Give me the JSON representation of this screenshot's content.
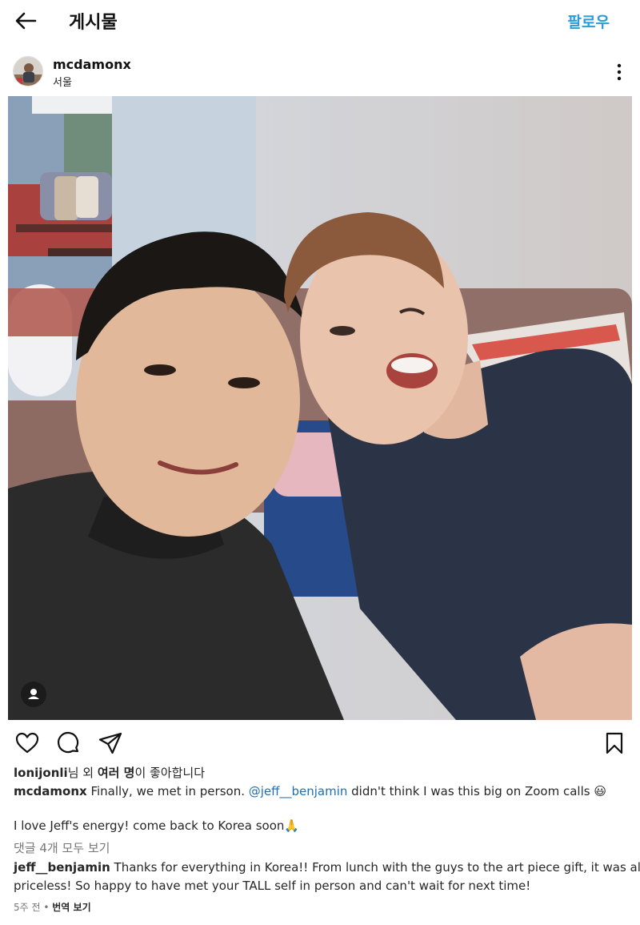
{
  "header": {
    "title": "게시물",
    "follow_label": "팔로우"
  },
  "post": {
    "username": "mcdamonx",
    "location": "서울"
  },
  "likes": {
    "user": "lonijonli",
    "mid1": "님 외 ",
    "others": "여러 명",
    "mid2": "이 좋아합니다"
  },
  "caption": {
    "username": "mcdamonx",
    "text1": " Finally, we met in person. ",
    "mention": "@jeff__benjamin",
    "text2": " didn't think I was this big on Zoom calls ",
    "emoji": "😃"
  },
  "caption2": {
    "text": "I love Jeff's energy! come back to Korea soon",
    "emoji": "🙏"
  },
  "view_comments": "댓글 4개 모두 보기",
  "comment": {
    "username": "jeff__benjamin",
    "line1": " Thanks for everything in Korea!! From lunch with the guys to the art piece gift, it was all",
    "line2": "priceless! So happy to have met your TALL self in person and can't wait for next time!"
  },
  "footer": {
    "time": "5주 전",
    "dot": "•",
    "translate": "번역 보기"
  },
  "colors": {
    "accent": "#2b9cd8",
    "mention": "#1d6fb0",
    "muted": "#777777"
  },
  "icons": [
    "back-arrow-icon",
    "more-vertical-icon",
    "heart-icon",
    "comment-icon",
    "share-icon",
    "bookmark-icon",
    "user-tag-icon"
  ]
}
